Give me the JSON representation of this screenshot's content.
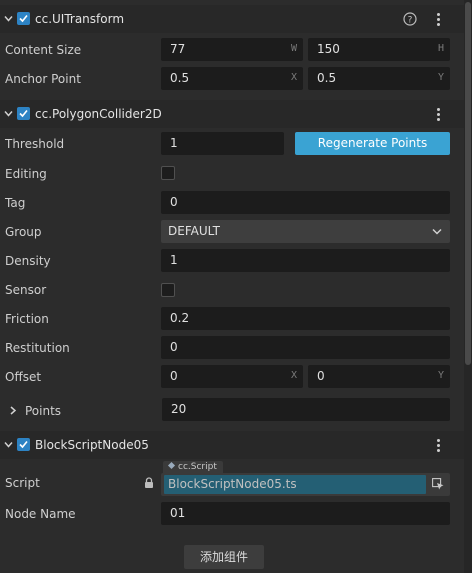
{
  "uitransform": {
    "title": "cc.UITransform",
    "content_size_label": "Content Size",
    "width_value": "77",
    "width_axis": "W",
    "height_value": "150",
    "height_axis": "H",
    "anchor_point_label": "Anchor Point",
    "anchor_x_value": "0.5",
    "anchor_x_axis": "X",
    "anchor_y_value": "0.5",
    "anchor_y_axis": "Y"
  },
  "polygon_collider": {
    "title": "cc.PolygonCollider2D",
    "threshold_label": "Threshold",
    "threshold_value": "1",
    "regenerate_button": "Regenerate Points",
    "editing_label": "Editing",
    "editing_checked": false,
    "tag_label": "Tag",
    "tag_value": "0",
    "group_label": "Group",
    "group_value": "DEFAULT",
    "density_label": "Density",
    "density_value": "1",
    "sensor_label": "Sensor",
    "sensor_checked": false,
    "friction_label": "Friction",
    "friction_value": "0.2",
    "restitution_label": "Restitution",
    "restitution_value": "0",
    "offset_label": "Offset",
    "offset_x_value": "0",
    "offset_x_axis": "X",
    "offset_y_value": "0",
    "offset_y_axis": "Y",
    "points_label": "Points",
    "points_value": "20"
  },
  "script_component": {
    "title": "BlockScriptNode05",
    "script_label": "Script",
    "script_type_tag": "cc.Script",
    "script_value": "BlockScriptNode05.ts",
    "node_name_label": "Node Name",
    "node_name_value": "01"
  },
  "footer": {
    "add_component_button": "添加组件"
  },
  "colors": {
    "accent": "#2d83c4",
    "button": "#3aa3d3",
    "script_field": "#245f74",
    "field_bg": "#1c1c1c",
    "panel_bg": "#2c2c2c"
  },
  "icons": [
    "chevron-down-icon",
    "chevron-right-icon",
    "help-icon",
    "more-icon",
    "lock-icon",
    "select-asset-icon",
    "dropdown-arrow-icon"
  ]
}
